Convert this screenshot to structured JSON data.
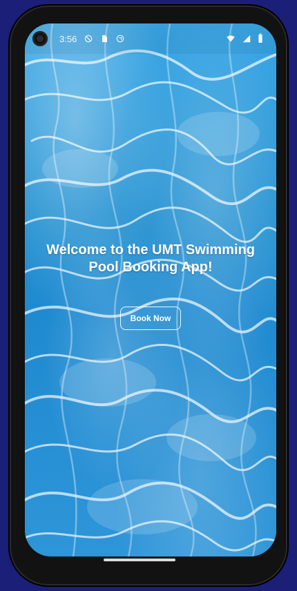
{
  "status_bar": {
    "time": "3:56",
    "icons": [
      "do-not-disturb-icon",
      "sim-card-icon",
      "sync-icon",
      "wifi-icon",
      "cellular-signal-icon",
      "battery-icon"
    ]
  },
  "main": {
    "welcome_text": "Welcome to the UMT Swimming Pool Booking App!",
    "book_button_label": "Book Now"
  },
  "colors": {
    "water_primary": "#1f92d3",
    "water_light": "#3aa7e6",
    "button_border": "#ffffff",
    "text": "#ffffff"
  }
}
